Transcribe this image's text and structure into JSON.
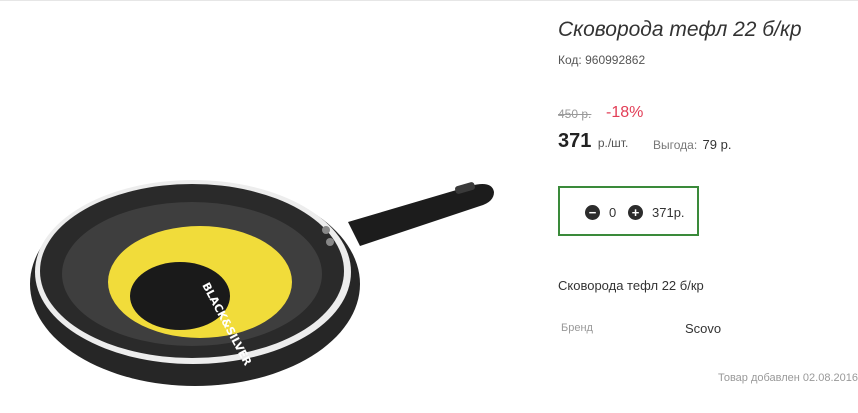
{
  "product": {
    "title": "Сковорода тефл 22 б/кр",
    "code_label": "Код:",
    "code_value": "960992862",
    "old_price": "450 р.",
    "discount": "-18%",
    "price": "371",
    "price_unit": "р./шт.",
    "benefit_label": "Выгода:",
    "benefit_value": "79 р.",
    "image_label": "BLACK&SILVER"
  },
  "cart": {
    "quantity": "0",
    "total": "371р.",
    "minus_symbol": "−",
    "plus_symbol": "+"
  },
  "details": {
    "description": "Сковорода тефл 22 б/кр",
    "brand_label": "Бренд",
    "brand_value": "Scovo",
    "added_text": "Товар добавлен 02.08.2016"
  },
  "colors": {
    "discount": "#e23d56",
    "qty_border": "#3a8a3a"
  },
  "icons": {
    "minus": "minus-circle-icon",
    "plus": "plus-circle-icon"
  }
}
